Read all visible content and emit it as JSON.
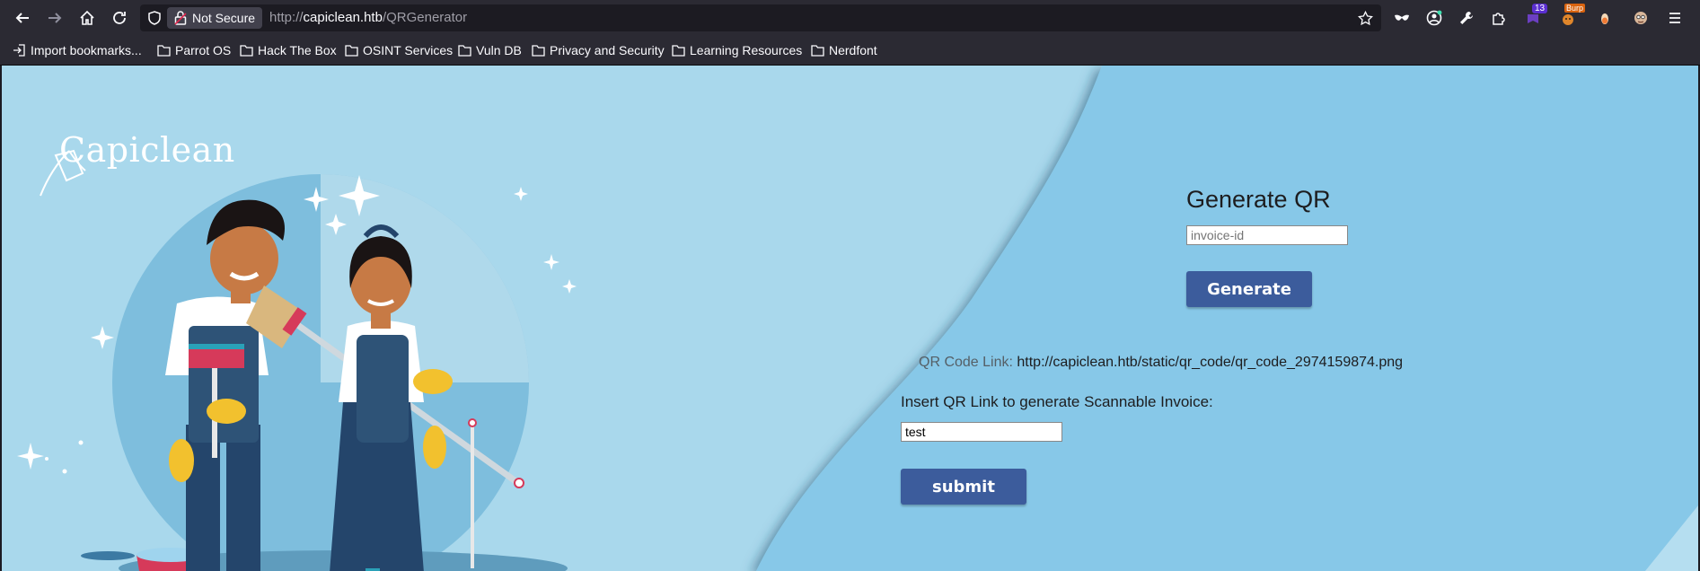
{
  "browser": {
    "security_label": "Not Secure",
    "url_scheme": "http://",
    "url_host": "capiclean.htb",
    "url_path": "/QRGenerator",
    "extension_badge": "13",
    "burp_badge": "Burp"
  },
  "bookmarks": [
    {
      "label": "Import bookmarks..."
    },
    {
      "label": "Parrot OS"
    },
    {
      "label": "Hack The Box"
    },
    {
      "label": "OSINT Services"
    },
    {
      "label": "Vuln DB"
    },
    {
      "label": "Privacy and Security"
    },
    {
      "label": "Learning Resources"
    },
    {
      "label": "Nerdfont"
    }
  ],
  "page": {
    "logo": "Capiclean",
    "generate": {
      "title": "Generate QR",
      "invoice_placeholder": "invoice-id",
      "invoice_value": "",
      "button_label": "Generate"
    },
    "qr_result": {
      "label": "QR Code Link:",
      "value": "http://capiclean.htb/static/qr_code/qr_code_2974159874.png"
    },
    "scan": {
      "label": "Insert QR Link to generate Scannable Invoice:",
      "input_value": "test",
      "button_label": "submit"
    }
  },
  "colors": {
    "page_bg": "#a9d8ec",
    "panel_bg": "#87c8e8",
    "button": "#3c5c9c",
    "toolbar": "#2b2a33"
  }
}
